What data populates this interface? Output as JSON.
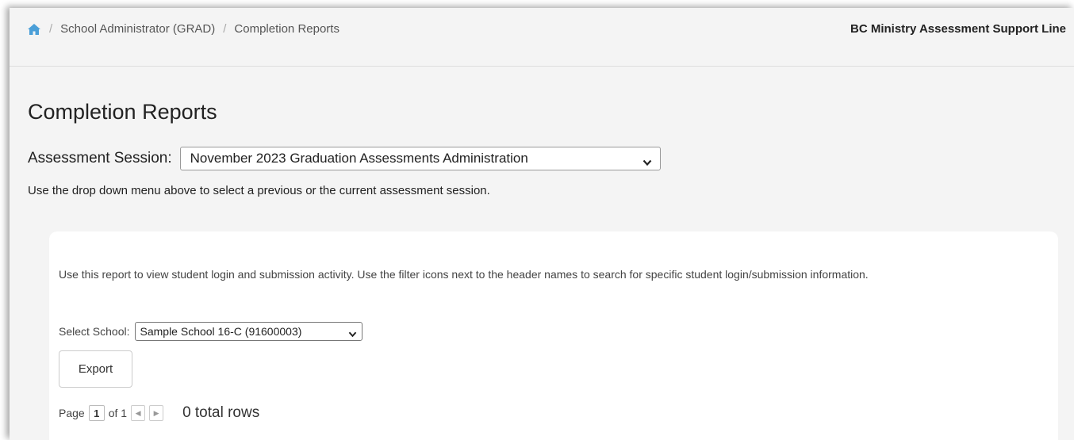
{
  "breadcrumb": {
    "home_icon": "home-icon",
    "separator": "/",
    "items": [
      "School Administrator (GRAD)",
      "Completion Reports"
    ]
  },
  "header": {
    "support_link": "BC Ministry Assessment Support Line"
  },
  "page": {
    "title": "Completion Reports"
  },
  "session": {
    "label": "Assessment Session:",
    "selected": "November 2023 Graduation Assessments Administration",
    "help": "Use the drop down menu above to select a previous or the current assessment session."
  },
  "report": {
    "description": "Use this report to view student login and submission activity. Use the filter icons next to the header names to search for specific student login/submission information.",
    "school_label": "Select School:",
    "school_selected": "Sample School 16-C (91600003)",
    "export_label": "Export",
    "pager": {
      "page_label": "Page",
      "current_page": "1",
      "of_label": "of 1",
      "prev_icon": "◀",
      "next_icon": "▶",
      "total_rows": "0 total rows"
    }
  },
  "colors": {
    "accent": "#4a9fd8",
    "window_bg": "#f4f4f4",
    "card_bg": "#ffffff"
  }
}
